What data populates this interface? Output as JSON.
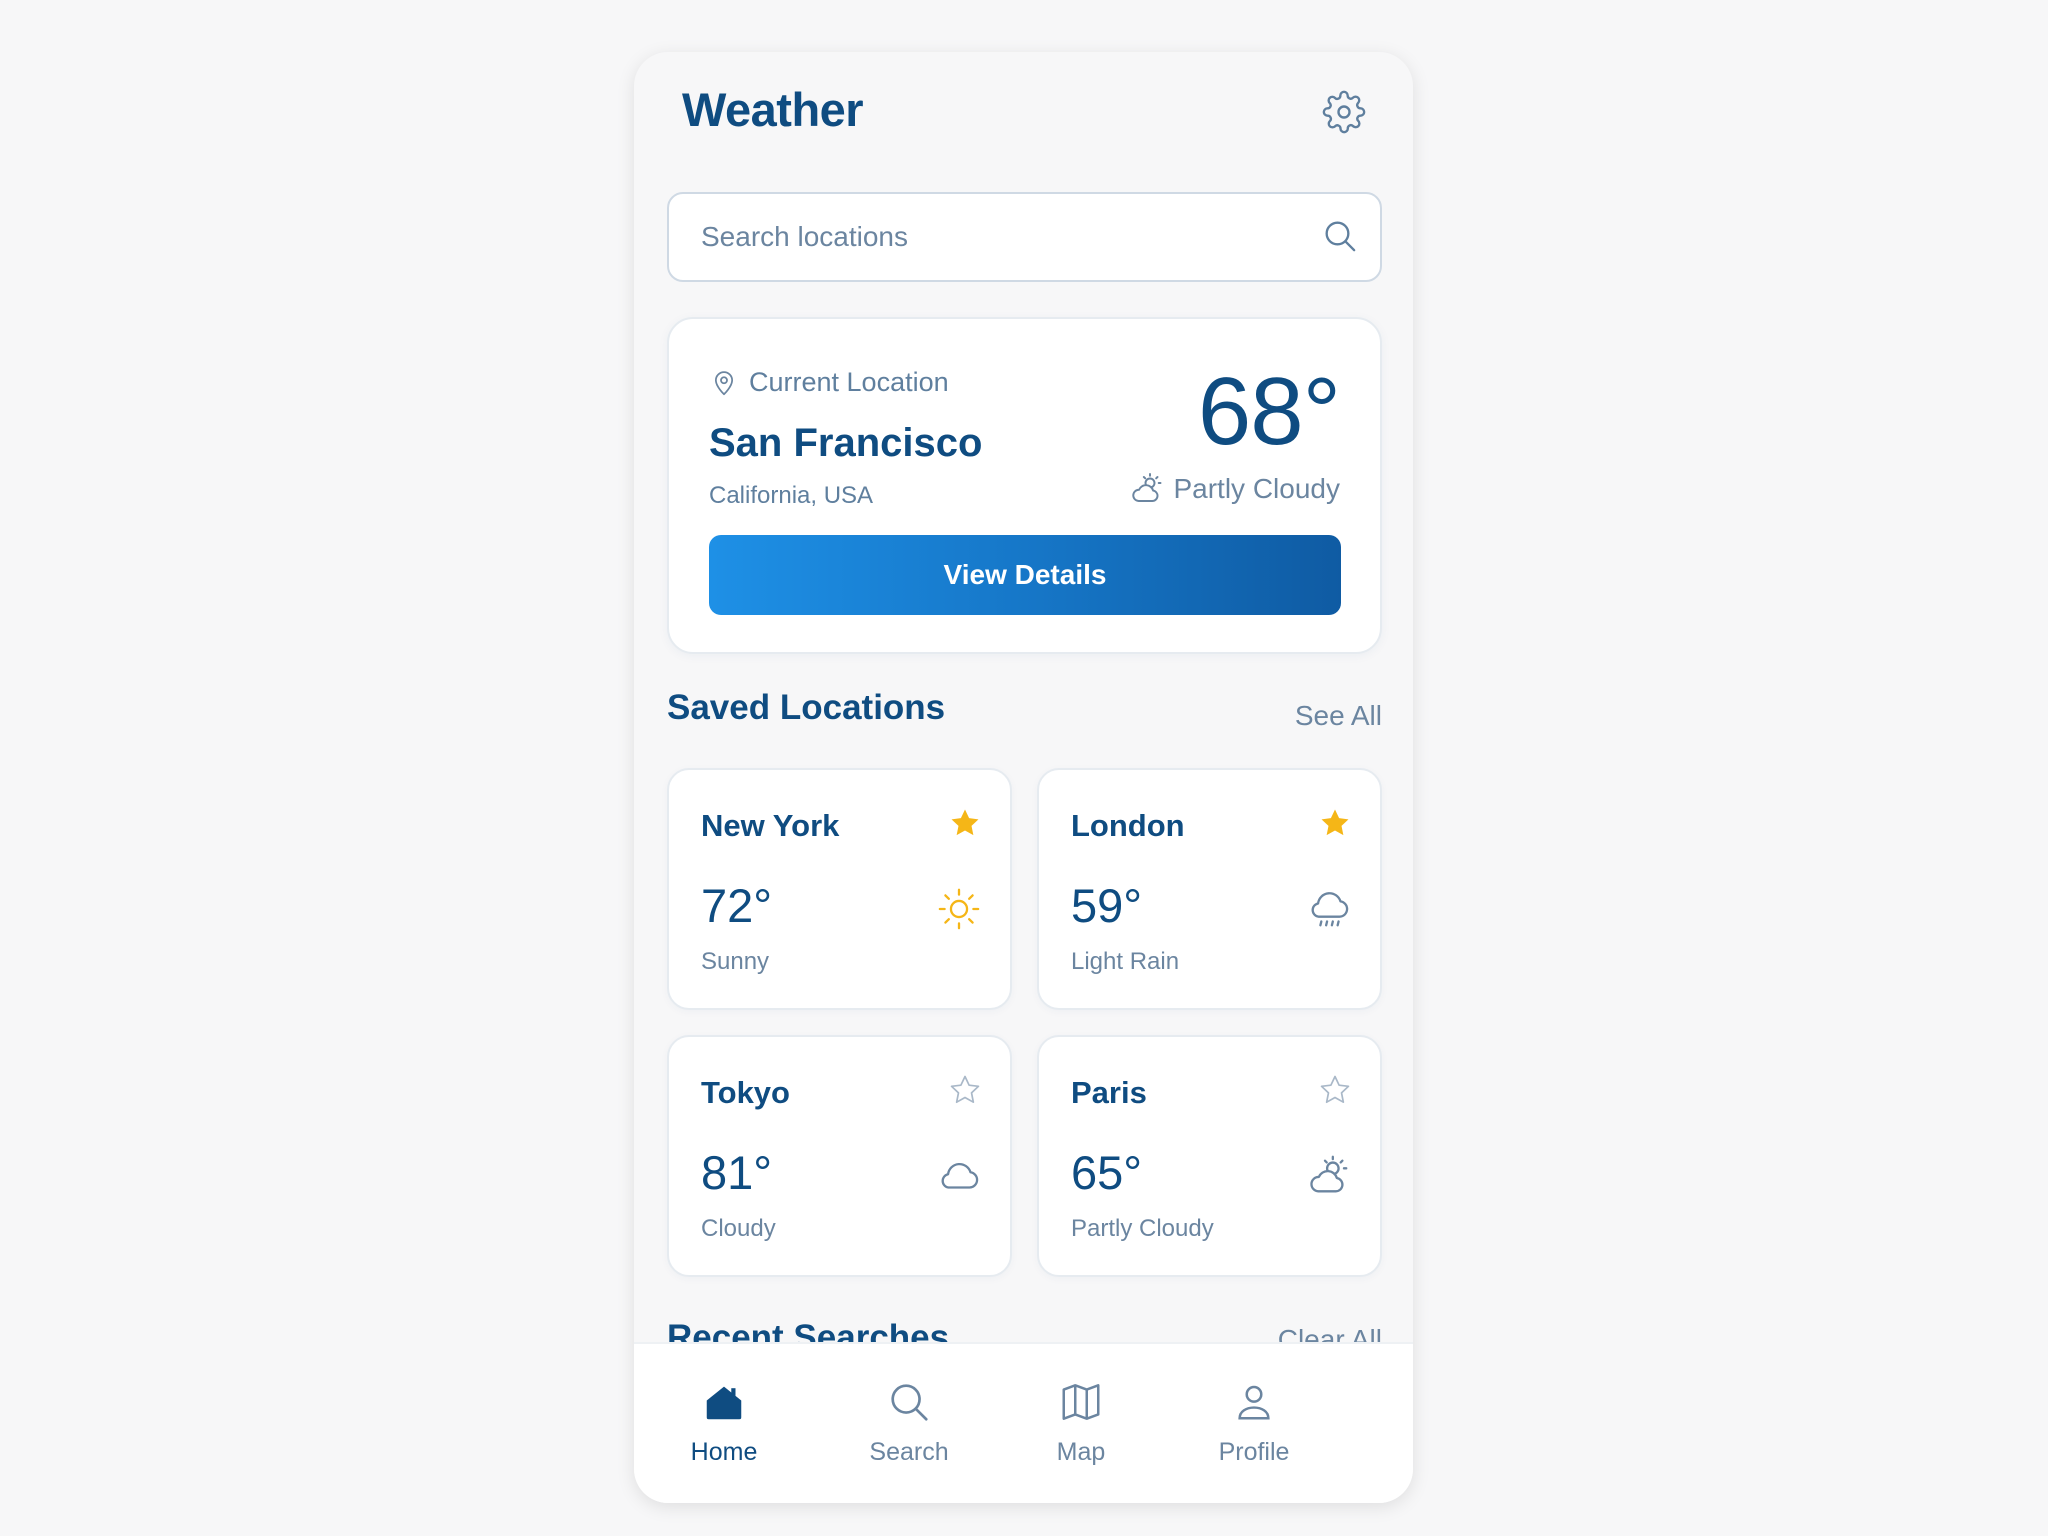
{
  "app": {
    "title": "Weather"
  },
  "search": {
    "placeholder": "Search locations"
  },
  "current": {
    "label": "Current Location",
    "city": "San Francisco",
    "region": "California, USA",
    "temp": "68°",
    "condition": "Partly Cloudy",
    "button_label": "View Details"
  },
  "saved": {
    "title": "Saved Locations",
    "link": "See All",
    "items": [
      {
        "city": "New York",
        "temp": "72°",
        "condition": "Sunny",
        "favorite": true,
        "icon": "sun-icon"
      },
      {
        "city": "London",
        "temp": "59°",
        "condition": "Light Rain",
        "favorite": true,
        "icon": "rain-icon"
      },
      {
        "city": "Tokyo",
        "temp": "81°",
        "condition": "Cloudy",
        "favorite": false,
        "icon": "cloud-icon"
      },
      {
        "city": "Paris",
        "temp": "65°",
        "condition": "Partly Cloudy",
        "favorite": false,
        "icon": "partly-cloudy-icon"
      }
    ]
  },
  "recent": {
    "title": "Recent Searches",
    "link": "Clear All"
  },
  "nav": {
    "items": [
      {
        "label": "Home",
        "icon": "home-icon",
        "active": true
      },
      {
        "label": "Search",
        "icon": "search-icon",
        "active": false
      },
      {
        "label": "Map",
        "icon": "map-icon",
        "active": false
      },
      {
        "label": "Profile",
        "icon": "profile-icon",
        "active": false
      }
    ]
  },
  "colors": {
    "primary": "#0f4c81",
    "muted": "#6b85a0",
    "star": "#f5b617",
    "button_start": "#1e90e6",
    "button_end": "#0f5ba3"
  }
}
